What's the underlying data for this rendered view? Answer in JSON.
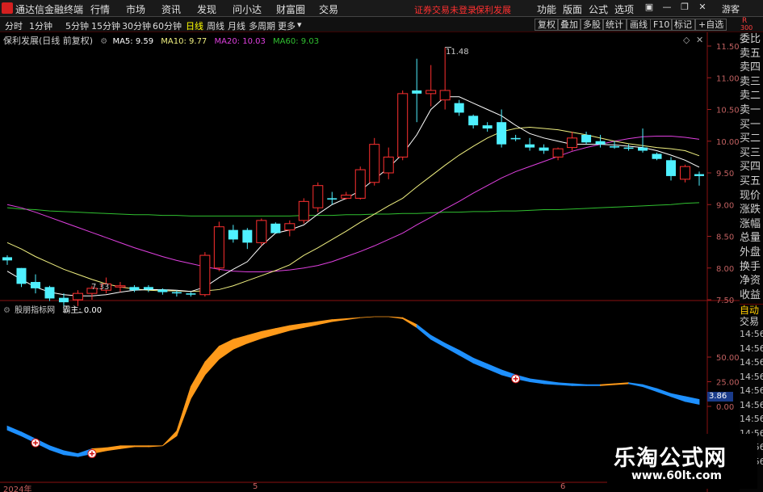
{
  "app": {
    "title": "通达信金融终端"
  },
  "menu": [
    "行情",
    "市场",
    "资讯",
    "发现",
    "问小达",
    "财富圈",
    "交易"
  ],
  "status_text": "证券交易未登录",
  "status_stock": "保利发展",
  "menu_right": [
    "功能",
    "版面",
    "公式",
    "选项"
  ],
  "guest": "游客",
  "periods": [
    "分时",
    "1分钟",
    "5分钟",
    "15分钟",
    "30分钟",
    "60分钟",
    "日线",
    "周线",
    "月线",
    "多周期",
    "更多"
  ],
  "active_period": "日线",
  "tools": [
    "复权",
    "叠加",
    "多股",
    "统计",
    "画线",
    "F10",
    "标记",
    "+自选"
  ],
  "corner": {
    "r": "R",
    "num": "300"
  },
  "main_panel": {
    "name": "保利发展(日线 前复权)",
    "ma5": "MA5: 9.59",
    "ma10": "MA10: 9.77",
    "ma20": "MA20: 10.03",
    "ma60": "MA60: 9.03",
    "high_label": "11.48",
    "low_label": "7.33"
  },
  "sub_panel": {
    "name": "股朋指标网",
    "value": "霸主: 0.00",
    "current": "3.86"
  },
  "right_labels": [
    "委比",
    "卖五",
    "卖四",
    "卖三",
    "卖二",
    "卖一",
    "买一",
    "买二",
    "买三",
    "买四",
    "买五",
    "现价",
    "涨跌",
    "涨幅",
    "总量",
    "外盘",
    "换手",
    "净资",
    "收益"
  ],
  "right_labels2": [
    "自动",
    "交易"
  ],
  "right_times": [
    "14:56",
    "14:56",
    "14:56",
    "14:56",
    "14:56",
    "14:56",
    "14:56",
    "14:56",
    "14:56",
    "14:56"
  ],
  "x_axis": [
    "2024年",
    "5",
    "6"
  ],
  "watermark": {
    "title": "乐淘公式网",
    "url": "www.60lt.com"
  },
  "colors": {
    "up": "#ff3030",
    "down": "#4ff0ff",
    "ma5": "#ffffff",
    "ma10": "#f0f080",
    "ma20": "#e040e0",
    "ma60": "#30c030",
    "orange": "#ff9a1a",
    "blue": "#1e90ff"
  },
  "chart_data": {
    "type": "candlestick",
    "y_ticks": [
      7.5,
      8.0,
      8.5,
      9.0,
      9.5,
      10.0,
      10.5,
      11.0,
      11.5
    ],
    "sub_ticks": [
      0.0,
      25.0,
      50.0
    ],
    "candles": [
      [
        8.17,
        8.2,
        8.05,
        8.12
      ],
      [
        8.0,
        8.0,
        7.7,
        7.75
      ],
      [
        7.78,
        7.9,
        7.6,
        7.68
      ],
      [
        7.7,
        7.72,
        7.48,
        7.52
      ],
      [
        7.53,
        7.6,
        7.4,
        7.46
      ],
      [
        7.5,
        7.65,
        7.4,
        7.6
      ],
      [
        7.6,
        7.72,
        7.5,
        7.68
      ],
      [
        7.65,
        7.85,
        7.6,
        7.75
      ],
      [
        7.7,
        7.78,
        7.62,
        7.72
      ],
      [
        7.7,
        7.73,
        7.62,
        7.65
      ],
      [
        7.7,
        7.73,
        7.62,
        7.66
      ],
      [
        7.66,
        7.68,
        7.58,
        7.62
      ],
      [
        7.62,
        7.65,
        7.55,
        7.6
      ],
      [
        7.6,
        7.62,
        7.55,
        7.58
      ],
      [
        7.58,
        8.25,
        7.55,
        8.2
      ],
      [
        8.0,
        8.73,
        7.95,
        8.65
      ],
      [
        8.6,
        8.68,
        8.4,
        8.45
      ],
      [
        8.6,
        8.63,
        8.3,
        8.4
      ],
      [
        8.4,
        8.78,
        8.35,
        8.75
      ],
      [
        8.7,
        8.72,
        8.55,
        8.55
      ],
      [
        8.6,
        8.75,
        8.5,
        8.7
      ],
      [
        8.75,
        9.1,
        8.7,
        9.05
      ],
      [
        8.95,
        9.35,
        8.88,
        9.3
      ],
      [
        9.1,
        9.2,
        9.0,
        9.08
      ],
      [
        9.1,
        9.2,
        9.08,
        9.15
      ],
      [
        9.1,
        9.6,
        9.08,
        9.55
      ],
      [
        9.35,
        10.05,
        9.3,
        9.95
      ],
      [
        9.5,
        9.9,
        9.4,
        9.75
      ],
      [
        9.75,
        10.8,
        9.7,
        10.75
      ],
      [
        10.8,
        11.3,
        10.3,
        10.75
      ],
      [
        10.75,
        11.2,
        10.55,
        10.8
      ],
      [
        10.65,
        11.48,
        10.5,
        10.8
      ],
      [
        10.6,
        10.65,
        10.4,
        10.45
      ],
      [
        10.4,
        10.42,
        10.2,
        10.25
      ],
      [
        10.25,
        10.3,
        10.15,
        10.2
      ],
      [
        10.3,
        10.5,
        9.9,
        9.95
      ],
      [
        10.05,
        10.1,
        10.0,
        10.03
      ],
      [
        9.95,
        10.05,
        9.85,
        9.9
      ],
      [
        9.9,
        9.95,
        9.8,
        9.85
      ],
      [
        9.75,
        9.9,
        9.7,
        9.88
      ],
      [
        9.9,
        10.15,
        9.85,
        10.05
      ],
      [
        10.1,
        10.15,
        9.95,
        9.98
      ],
      [
        10.0,
        10.1,
        9.9,
        9.95
      ],
      [
        9.92,
        10.0,
        9.88,
        9.9
      ],
      [
        9.9,
        9.95,
        9.85,
        9.88
      ],
      [
        9.9,
        10.2,
        9.82,
        9.85
      ],
      [
        9.8,
        9.82,
        9.7,
        9.72
      ],
      [
        9.7,
        9.75,
        9.38,
        9.45
      ],
      [
        9.4,
        9.63,
        9.35,
        9.6
      ],
      [
        9.48,
        9.52,
        9.3,
        9.45
      ]
    ],
    "ma5": [
      7.95,
      7.82,
      7.7,
      7.62,
      7.58,
      7.56,
      7.56,
      7.58,
      7.62,
      7.65,
      7.66,
      7.66,
      7.65,
      7.63,
      7.7,
      7.85,
      7.98,
      8.1,
      8.35,
      8.55,
      8.6,
      8.68,
      8.85,
      9.0,
      9.1,
      9.22,
      9.4,
      9.58,
      9.8,
      10.1,
      10.5,
      10.7,
      10.7,
      10.6,
      10.5,
      10.4,
      10.25,
      10.12,
      10.05,
      10.0,
      9.95,
      9.95,
      9.95,
      9.94,
      9.92,
      9.9,
      9.85,
      9.78,
      9.7,
      9.59
    ],
    "ma10": [
      8.4,
      8.3,
      8.18,
      8.08,
      7.98,
      7.9,
      7.82,
      7.75,
      7.7,
      7.67,
      7.65,
      7.64,
      7.64,
      7.63,
      7.64,
      7.66,
      7.72,
      7.8,
      7.88,
      7.96,
      8.05,
      8.2,
      8.32,
      8.45,
      8.58,
      8.72,
      8.85,
      8.98,
      9.1,
      9.28,
      9.45,
      9.62,
      9.78,
      9.92,
      10.05,
      10.15,
      10.2,
      10.22,
      10.2,
      10.18,
      10.14,
      10.1,
      10.05,
      10.0,
      9.96,
      9.93,
      9.9,
      9.88,
      9.85,
      9.77
    ],
    "ma20": [
      9.0,
      8.95,
      8.88,
      8.8,
      8.72,
      8.64,
      8.56,
      8.48,
      8.4,
      8.32,
      8.25,
      8.18,
      8.12,
      8.07,
      8.02,
      7.98,
      7.95,
      7.94,
      7.94,
      7.95,
      7.97,
      8.0,
      8.04,
      8.1,
      8.18,
      8.26,
      8.35,
      8.45,
      8.55,
      8.68,
      8.8,
      8.93,
      9.05,
      9.18,
      9.3,
      9.42,
      9.52,
      9.6,
      9.68,
      9.76,
      9.84,
      9.9,
      9.95,
      10.0,
      10.04,
      10.07,
      10.08,
      10.08,
      10.06,
      10.03
    ],
    "ma60": [
      8.95,
      8.93,
      8.92,
      8.9,
      8.89,
      8.88,
      8.87,
      8.86,
      8.85,
      8.84,
      8.84,
      8.83,
      8.83,
      8.82,
      8.82,
      8.82,
      8.82,
      8.82,
      8.82,
      8.82,
      8.82,
      8.83,
      8.83,
      8.83,
      8.84,
      8.84,
      8.85,
      8.85,
      8.86,
      8.86,
      8.87,
      8.88,
      8.88,
      8.89,
      8.89,
      8.9,
      8.9,
      8.91,
      8.92,
      8.92,
      8.93,
      8.94,
      8.95,
      8.96,
      8.97,
      8.98,
      8.99,
      9.0,
      9.02,
      9.03
    ],
    "sub_upper": [
      -20,
      -26,
      -33,
      -40,
      -45,
      -48,
      -43,
      -42,
      -40,
      -40,
      -40,
      -40,
      -25,
      20,
      45,
      61,
      68,
      72,
      76,
      79,
      82,
      84,
      86,
      88,
      89,
      90,
      91,
      91,
      90,
      83,
      72,
      64,
      57,
      49,
      43,
      37,
      32,
      28,
      26,
      24,
      23,
      22,
      22,
      23,
      24,
      22,
      18,
      13,
      10,
      7
    ],
    "sub_lower": [
      -24,
      -30,
      -37,
      -44,
      -49,
      -51,
      -48,
      -45,
      -43,
      -41,
      -41,
      -40,
      -30,
      8,
      32,
      48,
      58,
      64,
      69,
      73,
      77,
      80,
      83,
      86,
      88,
      90,
      91,
      91,
      89,
      80,
      68,
      60,
      52,
      44,
      38,
      32,
      28,
      25,
      23,
      22,
      21,
      21,
      21,
      22,
      23,
      20,
      15,
      10,
      5,
      2
    ],
    "sub_color": [
      "blue",
      "blue",
      "blue",
      "blue",
      "blue",
      "blue",
      "orange",
      "orange",
      "orange",
      "orange",
      "orange",
      "orange",
      "orange",
      "orange",
      "orange",
      "orange",
      "orange",
      "orange",
      "orange",
      "orange",
      "orange",
      "orange",
      "orange",
      "orange",
      "orange",
      "orange",
      "orange",
      "orange",
      "orange",
      "blue",
      "blue",
      "blue",
      "blue",
      "blue",
      "blue",
      "blue",
      "blue",
      "blue",
      "blue",
      "blue",
      "blue",
      "blue",
      "orange",
      "orange",
      "blue",
      "blue",
      "blue",
      "blue",
      "blue",
      "blue"
    ],
    "sub_markers": [
      2,
      6,
      36
    ]
  }
}
